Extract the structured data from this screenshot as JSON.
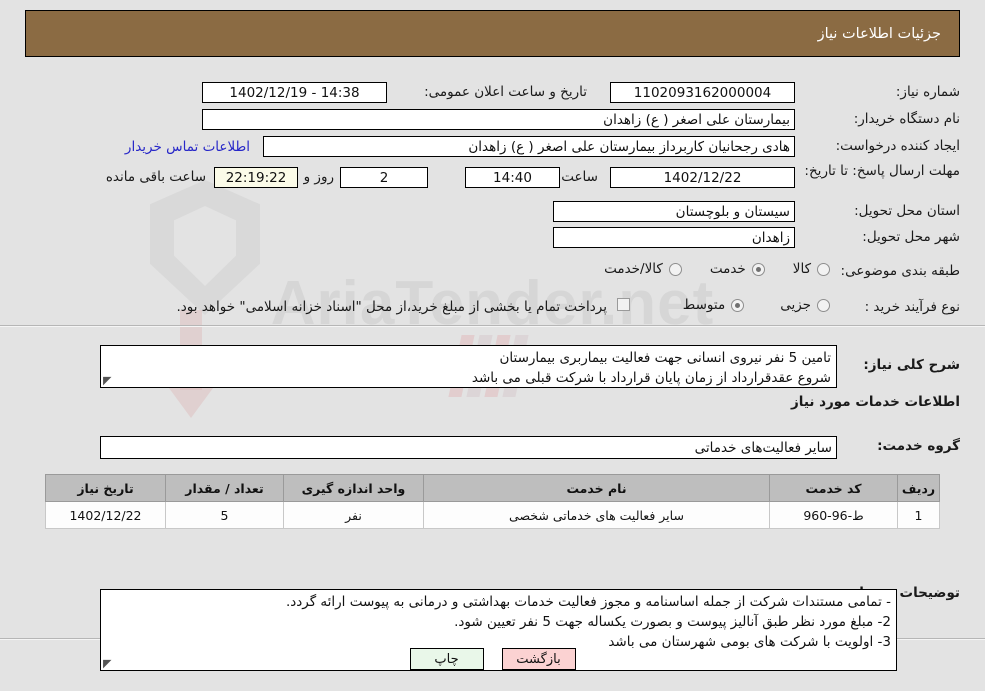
{
  "header": {
    "title": "جزئیات اطلاعات نیاز"
  },
  "form": {
    "need_number_label": "شماره نیاز:",
    "need_number_value": "1102093162000004",
    "announce_label": "تاریخ و ساعت اعلان عمومی:",
    "announce_value": "14:38 - 1402/12/19",
    "buyer_org_label": "نام دستگاه خریدار:",
    "buyer_org_value": "بیمارستان علی اصغر ( ع) زاهدان",
    "creator_label": "ایجاد کننده درخواست:",
    "creator_value": "هادی رجحانیان کاربرداز بیمارستان علی اصغر ( ع) زاهدان",
    "contact_link": "اطلاعات تماس خریدار",
    "deadline_label": "مهلت ارسال پاسخ: تا تاریخ:",
    "deadline_date": "1402/12/22",
    "hour_label": "ساعت",
    "hour_value": "14:40",
    "days_value": "2",
    "days_sep": "روز و",
    "countdown_value": "22:19:22",
    "countdown_suffix": "ساعت باقی مانده",
    "province_label": "استان محل تحویل:",
    "province_value": "سیستان و بلوچستان",
    "city_label": "شهر محل تحویل:",
    "city_value": "زاهدان",
    "category_label": "طبقه بندی موضوعی:",
    "category_options": [
      {
        "label": "کالا",
        "selected": false
      },
      {
        "label": "خدمت",
        "selected": true
      },
      {
        "label": "کالا/خدمت",
        "selected": false
      }
    ],
    "process_label": "نوع فرآیند خرید :",
    "process_options": [
      {
        "label": "جزیی",
        "selected": false
      },
      {
        "label": "متوسط",
        "selected": true
      }
    ],
    "treasury_checkbox_label": "پرداخت تمام یا بخشی از مبلغ خرید،از محل \"اسناد خزانه اسلامی\" خواهد بود.",
    "treasury_checked": false
  },
  "description": {
    "label": "شرح کلی نیاز:",
    "lines": [
      "تامین 5 نفر نیروی انسانی جهت فعالیت بیماربری بیمارستان",
      "شروع عقدقرارداد از زمان پایان قرارداد با شرکت قبلی می باشد"
    ]
  },
  "services_section": {
    "heading": "اطلاعات خدمات مورد نیاز",
    "group_label": "گروه خدمت:",
    "group_value": "سایر فعالیت‌های خدماتی",
    "table": {
      "columns": [
        "ردیف",
        "کد خدمت",
        "نام خدمت",
        "واحد اندازه گیری",
        "تعداد / مقدار",
        "تاریخ نیاز"
      ],
      "rows": [
        [
          "1",
          "ط-96-960",
          "سایر فعالیت های خدماتی شخصی",
          "نفر",
          "5",
          "1402/12/22"
        ]
      ]
    }
  },
  "buyer_notes": {
    "label": "توضیحات خریدار:",
    "lines": [
      "- تمامی مستندات شرکت از جمله اساسنامه و مجوز فعالیت خدمات بهداشتی و درمانی به پیوست ارائه گردد.",
      "2- مبلغ مورد نظر طبق آنالیز پیوست و بصورت یکساله جهت 5 نفر تعیین شود.",
      "3- اولویت با شرکت های بومی شهرستان می باشد"
    ]
  },
  "footer": {
    "print_label": "چاپ",
    "back_label": "بازگشت"
  },
  "colors": {
    "header_brown": "#8b6b43",
    "page_bg": "#e3e3e3",
    "link_blue": "#2727c8",
    "table_header_gray": "#bebebe",
    "print_green": "#e9f7e9",
    "back_pink": "#fbd2d2",
    "countdown_cream": "#fbfbe8"
  }
}
